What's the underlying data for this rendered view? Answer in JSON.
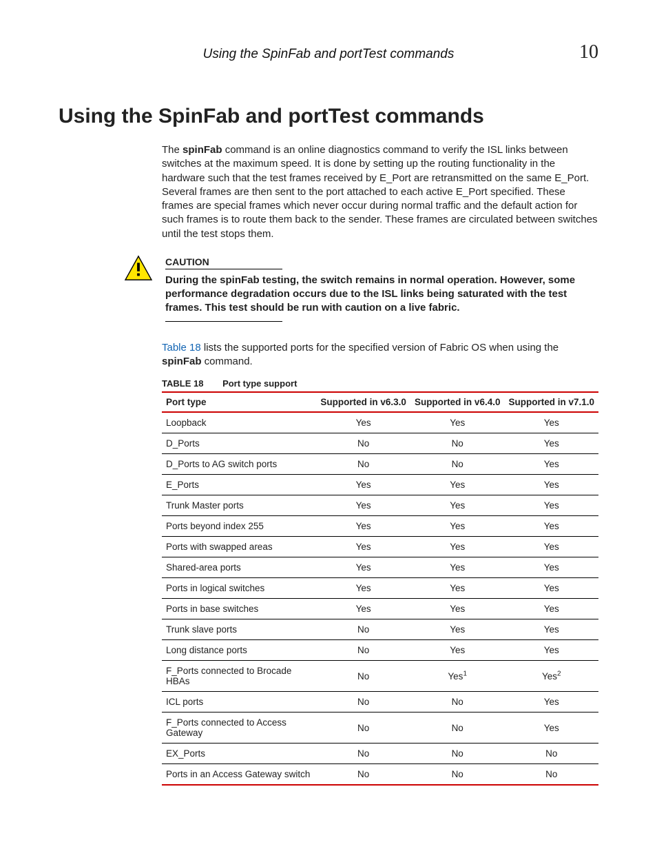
{
  "header": {
    "running_title": "Using the SpinFab and portTest commands",
    "chapter_number": "10"
  },
  "section": {
    "title": "Using the SpinFab and portTest commands",
    "intro_prefix": "The ",
    "intro_bold1": "spinFab",
    "intro_rest": " command is an online diagnostics command to verify the ISL links between switches at the maximum speed. It is done by setting up the routing functionality in the hardware such that the test frames received by E_Port are retransmitted on the same E_Port. Several frames are then sent to the port attached to each active E_Port specified. These frames are special frames which never occur during normal traffic and the default action for such frames is to route them back to the sender. These frames are circulated between switches until the test stops them."
  },
  "caution": {
    "label": "CAUTION",
    "body": "During the spinFab testing, the switch remains in normal operation. However, some performance degradation occurs due to the ISL links being saturated with the test frames. This test should be run with caution on a live fabric."
  },
  "table_ref": {
    "link_text": "Table 18",
    "rest": " lists the supported ports for the specified version of Fabric OS when using the ",
    "bold": "spinFab",
    "tail": " command."
  },
  "table": {
    "caption_label": "TABLE 18",
    "caption_title": "Port type support",
    "headers": [
      "Port type",
      "Supported in v6.3.0",
      "Supported in v6.4.0",
      "Supported in v7.1.0"
    ],
    "rows": [
      {
        "pt": "Loopback",
        "v63": "Yes",
        "v64": "Yes",
        "v71": "Yes"
      },
      {
        "pt": "D_Ports",
        "v63": "No",
        "v64": "No",
        "v71": "Yes"
      },
      {
        "pt": "D_Ports to AG switch ports",
        "v63": "No",
        "v64": "No",
        "v71": "Yes"
      },
      {
        "pt": "E_Ports",
        "v63": "Yes",
        "v64": "Yes",
        "v71": "Yes"
      },
      {
        "pt": "Trunk Master ports",
        "v63": "Yes",
        "v64": "Yes",
        "v71": "Yes"
      },
      {
        "pt": "Ports beyond index 255",
        "v63": "Yes",
        "v64": "Yes",
        "v71": "Yes"
      },
      {
        "pt": "Ports with swapped areas",
        "v63": "Yes",
        "v64": "Yes",
        "v71": "Yes"
      },
      {
        "pt": "Shared-area ports",
        "v63": "Yes",
        "v64": "Yes",
        "v71": "Yes"
      },
      {
        "pt": "Ports in logical switches",
        "v63": "Yes",
        "v64": "Yes",
        "v71": "Yes"
      },
      {
        "pt": "Ports in base switches",
        "v63": "Yes",
        "v64": "Yes",
        "v71": "Yes"
      },
      {
        "pt": "Trunk slave ports",
        "v63": "No",
        "v64": "Yes",
        "v71": "Yes"
      },
      {
        "pt": "Long distance ports",
        "v63": "No",
        "v64": "Yes",
        "v71": "Yes"
      },
      {
        "pt": "F_Ports connected to Brocade HBAs",
        "v63": "No",
        "v64": "Yes",
        "v64_sup": "1",
        "v71": "Yes",
        "v71_sup": "2"
      },
      {
        "pt": "ICL ports",
        "v63": "No",
        "v64": "No",
        "v71": "Yes"
      },
      {
        "pt": "F_Ports connected to Access Gateway",
        "v63": "No",
        "v64": "No",
        "v71": "Yes"
      },
      {
        "pt": "EX_Ports",
        "v63": "No",
        "v64": "No",
        "v71": "No"
      },
      {
        "pt": "Ports in an Access Gateway switch",
        "v63": "No",
        "v64": "No",
        "v71": "No"
      }
    ]
  }
}
